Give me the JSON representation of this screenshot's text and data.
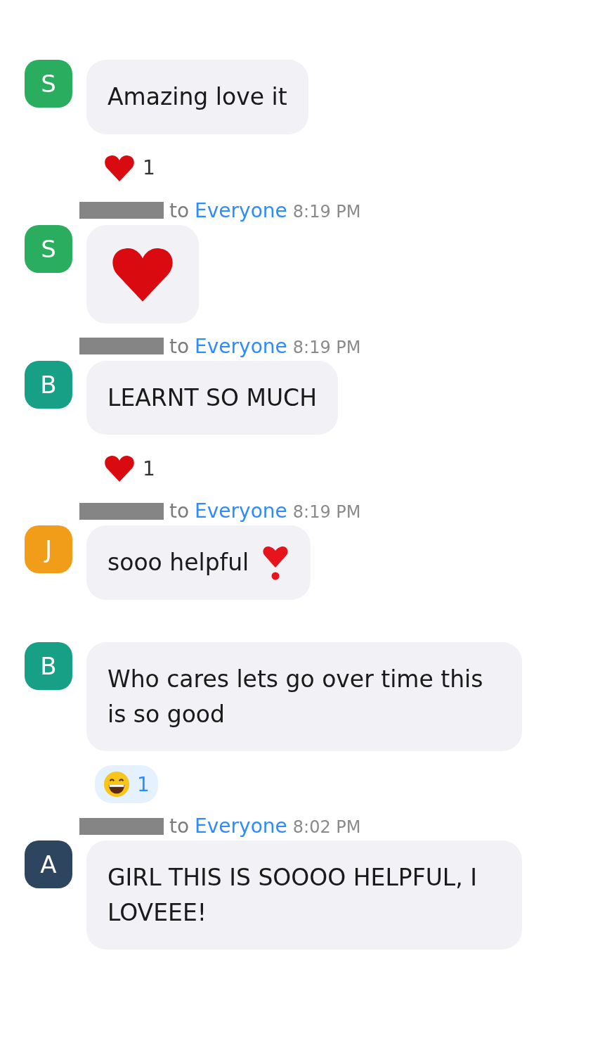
{
  "messages": [
    {
      "avatar": {
        "initial": "S",
        "color": "#2bad5f"
      },
      "kind": "text",
      "text": "Amazing love it",
      "reactions": [
        {
          "kind": "heart",
          "count": "1",
          "selected": false
        }
      ]
    },
    {
      "header": {
        "to": "to",
        "recipient": "Everyone",
        "time": "8:19 PM"
      },
      "avatar": {
        "initial": "S",
        "color": "#2bad5f"
      },
      "kind": "heart"
    },
    {
      "header": {
        "to": "to",
        "recipient": "Everyone",
        "time": "8:19 PM"
      },
      "avatar": {
        "initial": "B",
        "color": "#17a085"
      },
      "kind": "text",
      "text": "LEARNT SO MUCH",
      "reactions": [
        {
          "kind": "heart",
          "count": "1",
          "selected": false
        }
      ]
    },
    {
      "header": {
        "to": "to",
        "recipient": "Everyone",
        "time": "8:19 PM"
      },
      "avatar": {
        "initial": "J",
        "color": "#f29d1a"
      },
      "kind": "text",
      "text": "sooo helpful",
      "trailing_icon": {
        "kind": "heart_exclamation"
      }
    },
    {
      "avatar": {
        "initial": "B",
        "color": "#17a085"
      },
      "kind": "text",
      "text": "Who cares lets go over time this is so good",
      "reactions": [
        {
          "kind": "grin",
          "count": "1",
          "selected": true
        }
      ]
    },
    {
      "header": {
        "to": "to",
        "recipient": "Everyone",
        "time": "8:02 PM"
      },
      "avatar": {
        "initial": "A",
        "color": "#2d455f"
      },
      "kind": "text",
      "text": "GIRL THIS IS SOOOO HELPFUL, I LOVEEE!"
    }
  ]
}
